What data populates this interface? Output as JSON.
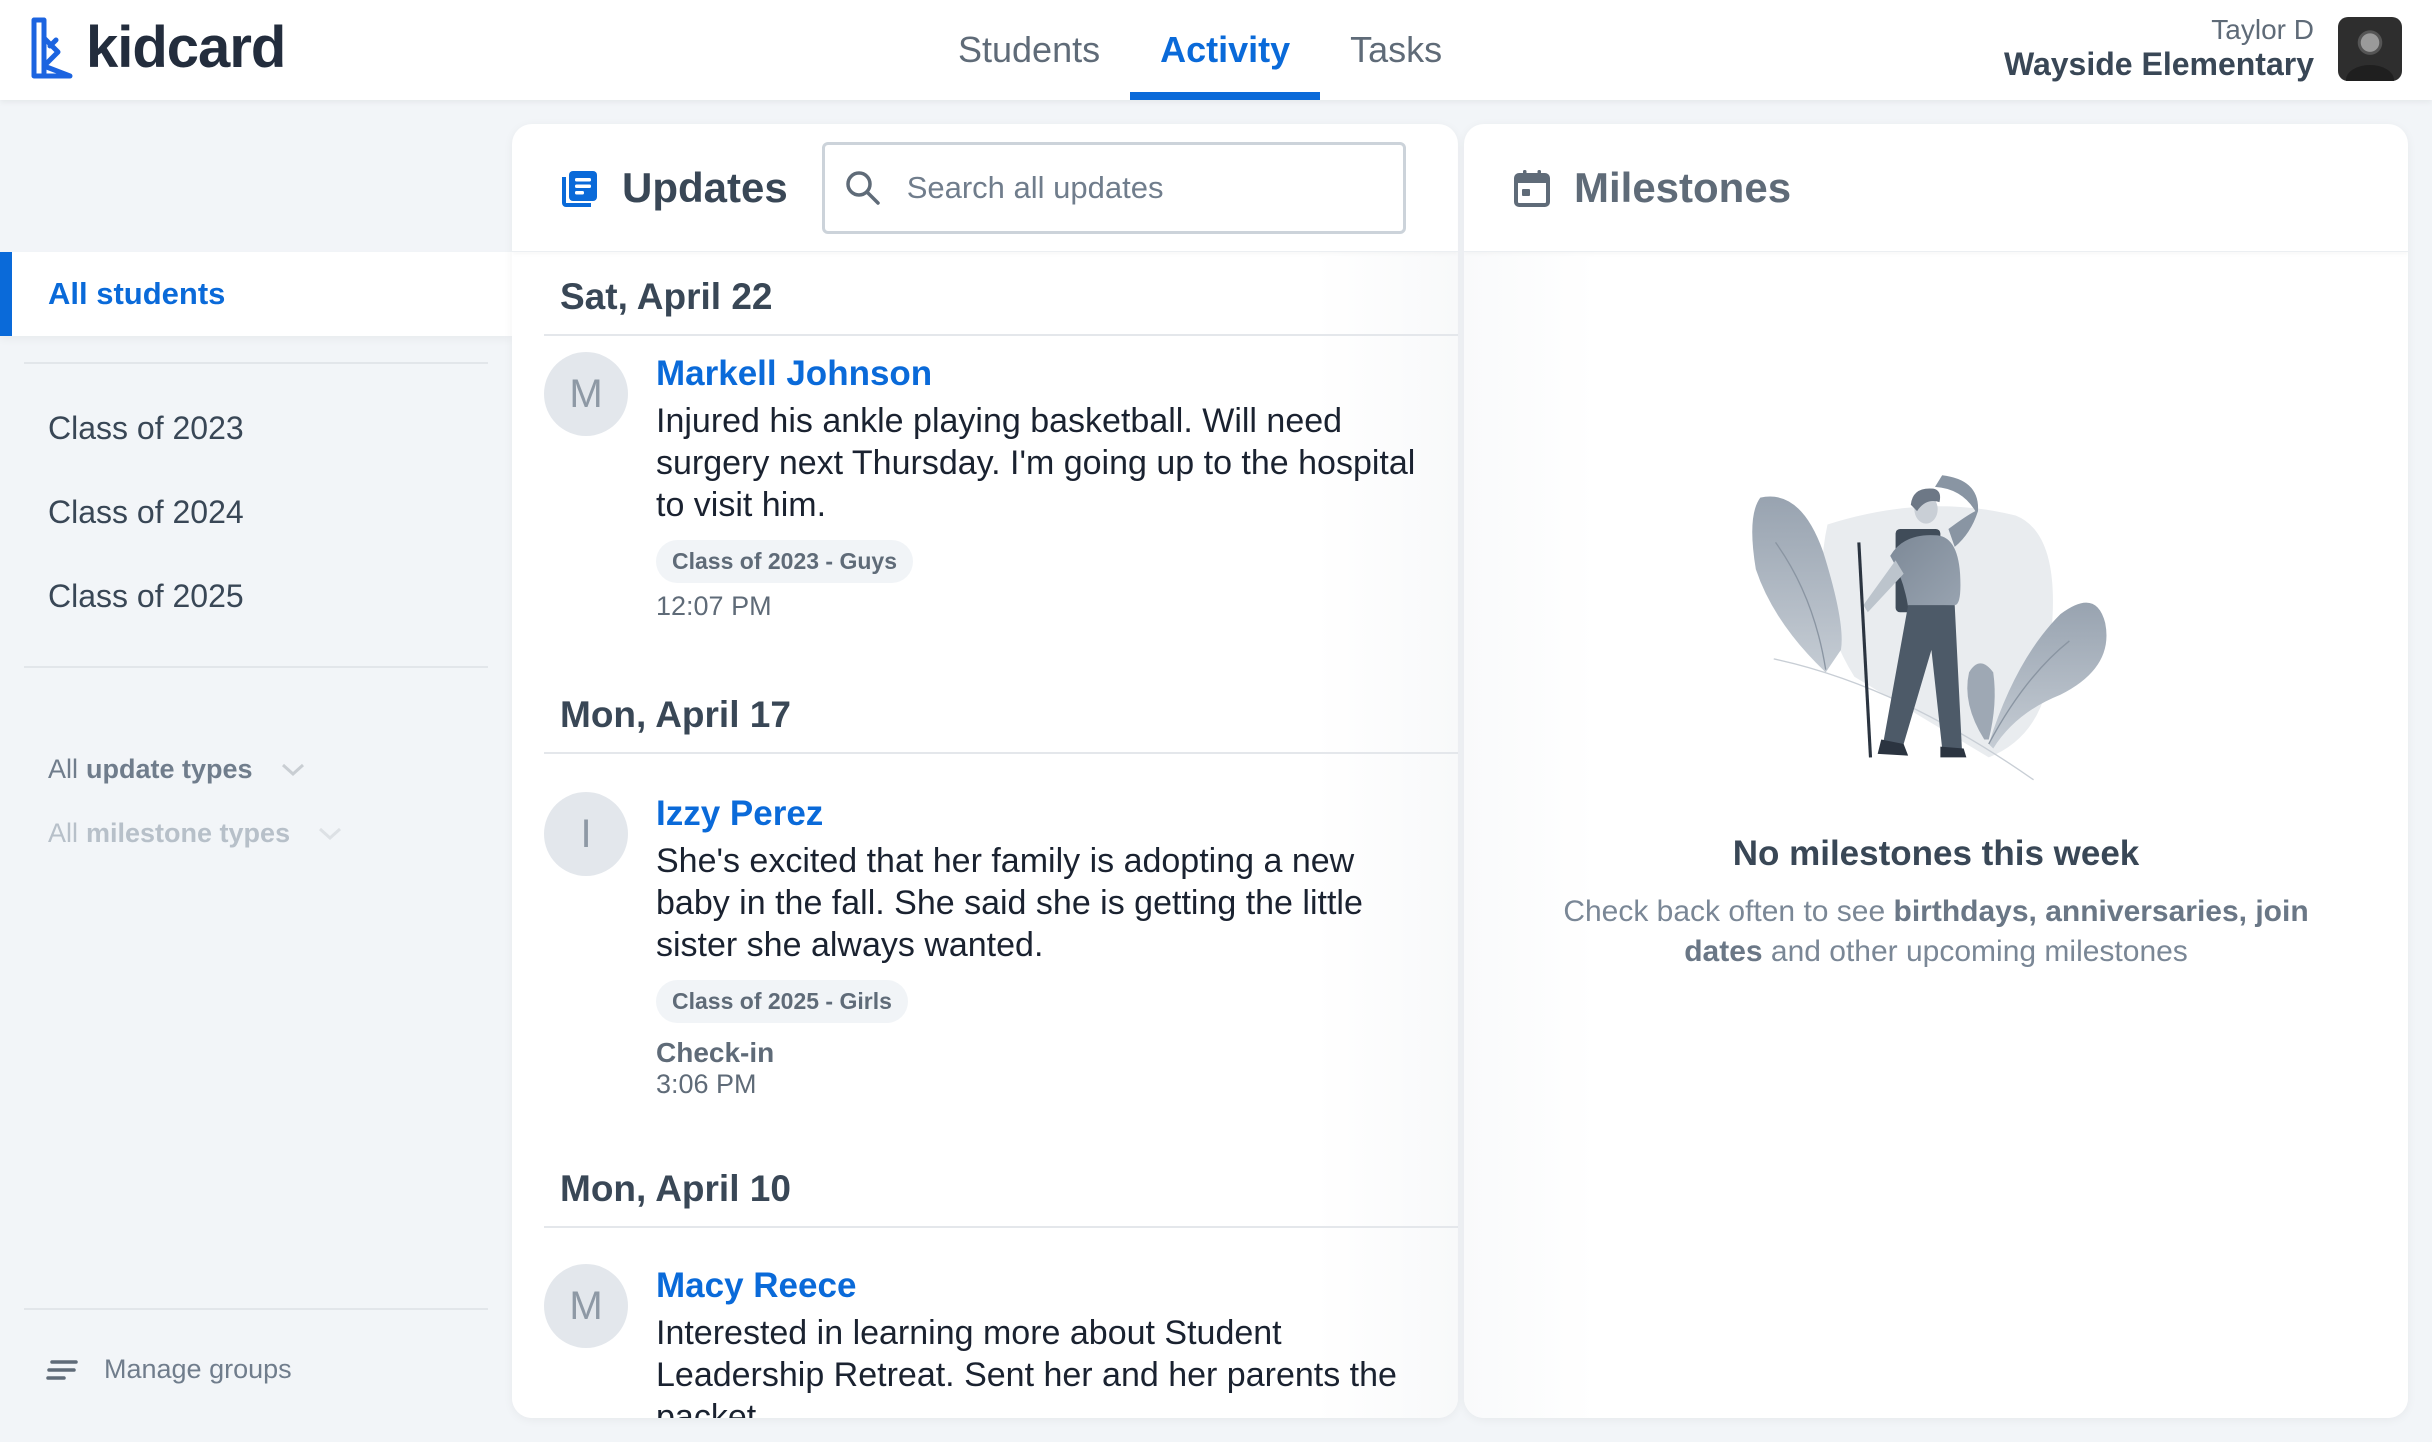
{
  "app": {
    "logo_text": "kidcard",
    "accent": "#0a6ad9"
  },
  "nav": {
    "tabs": [
      {
        "label": "Students",
        "active": false
      },
      {
        "label": "Activity",
        "active": true
      },
      {
        "label": "Tasks",
        "active": false
      }
    ]
  },
  "user": {
    "name": "Taylor D",
    "school": "Wayside Elementary"
  },
  "sidebar": {
    "active_item": "All students",
    "groups": [
      "Class of 2023",
      "Class of 2024",
      "Class of 2025"
    ],
    "filters": {
      "update_types": {
        "light": "All",
        "bold": "update types"
      },
      "milestone_types": {
        "light": "All",
        "bold": "milestone types"
      }
    },
    "manage_label": "Manage groups"
  },
  "updates": {
    "title": "Updates",
    "search_placeholder": "Search all updates",
    "days": [
      {
        "date": "Sat, April 22",
        "entries": [
          {
            "initial": "M",
            "name": "Markell Johnson",
            "text": "Injured his ankle playing basketball. Will need surgery next Thursday. I'm going up to the hospital to visit him.",
            "group": "Class of 2023 - Guys",
            "type": "",
            "time": "12:07 PM"
          }
        ]
      },
      {
        "date": "Mon, April 17",
        "entries": [
          {
            "initial": "I",
            "name": "Izzy Perez",
            "text": "She's excited that her family is adopting a new baby in the fall. She said she is getting the little sister she always wanted.",
            "group": "Class of 2025 - Girls",
            "type": "Check-in",
            "time": "3:06 PM"
          }
        ]
      },
      {
        "date": "Mon, April 10",
        "entries": [
          {
            "initial": "M",
            "name": "Macy Reece",
            "text": "Interested in learning more about Student Leadership Retreat. Sent her and her parents the packet.",
            "group": "",
            "type": "",
            "time": ""
          }
        ]
      }
    ]
  },
  "milestones": {
    "title": "Milestones",
    "empty_title": "No milestones this week",
    "empty_desc_prefix": "Check back often to see ",
    "empty_desc_bold": "birthdays, anniversaries, join dates",
    "empty_desc_suffix": " and other upcoming milestones"
  }
}
